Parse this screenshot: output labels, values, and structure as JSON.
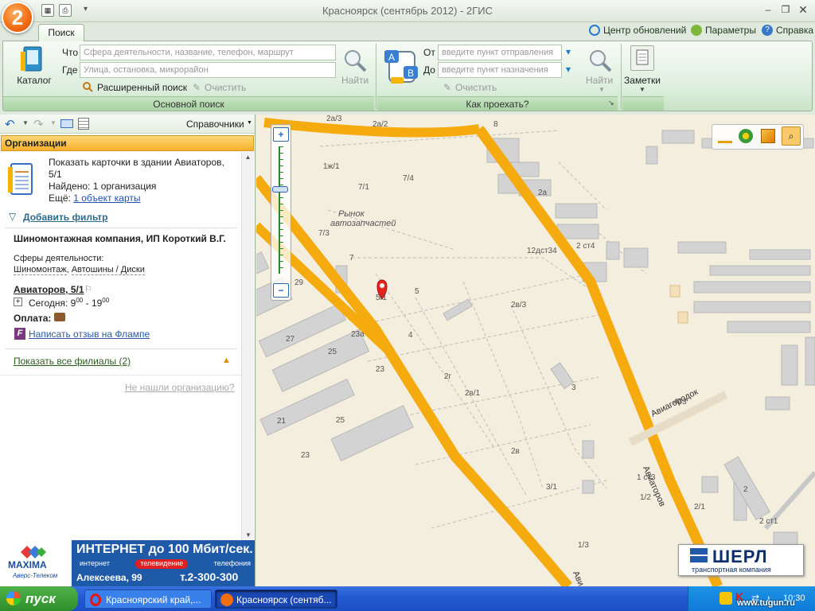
{
  "window": {
    "title": "Красноярск (сентябрь 2012)  -  2ГИС",
    "logo": "2"
  },
  "tabs": {
    "search": "Поиск"
  },
  "topright": {
    "updates": "Центр обновлений",
    "params": "Параметры",
    "help": "Справка"
  },
  "search": {
    "catalog": "Каталог",
    "what_label": "Что",
    "what_placeholder": "Сфера деятельности, название, телефон, маршрут",
    "where_label": "Где",
    "where_placeholder": "Улица, остановка, микрорайон",
    "find": "Найти",
    "advanced": "Расширенный поиск",
    "clear": "Очистить",
    "group": "Основной поиск"
  },
  "route": {
    "from_label": "От",
    "from_placeholder": "введите пункт отправления",
    "to_label": "До",
    "to_placeholder": "введите пункт назначения",
    "find": "Найти",
    "clear": "Очистить",
    "group": "Как проехать?"
  },
  "notes": {
    "label": "Заметки"
  },
  "panel": {
    "directory": "Справочники",
    "header": "Организации",
    "building_cards": "Показать карточки в здании Авиаторов, 5/1",
    "found": "Найдено: 1 организация",
    "more_prefix": "Ещё:",
    "more_link": "1 объект карты",
    "add_filter": "Добавить фильтр",
    "org_name": "Шиномонтажная компания, ИП Короткий В.Г.",
    "spheres_label": "Сферы деятельности:",
    "sphere1": "Шиномонтаж",
    "sphere2": "Автошины / Диски",
    "address": "Авиаторов, 5/1",
    "today": "Сегодня:",
    "open_h": "9",
    "open_m": "00",
    "close_h": "19",
    "close_m": "00",
    "payment": "Оплата:",
    "review": "Написать отзыв на Флампе",
    "branches": "Показать все филиалы (2)",
    "not_found": "Не нашли организацию?"
  },
  "ad": {
    "brand": "MAXIMA",
    "slogan": "ИНТЕРНЕТ до 100 Мбит/сек.",
    "tags": [
      "интернет",
      "телевидение",
      "телефония"
    ],
    "address": "Алексеева, 99",
    "phone": "т.2-300-300",
    "sub": "Аверс-Телеком"
  },
  "map": {
    "street1": "Авиаторов",
    "street2": "Авиагородок",
    "market1": "Рынок",
    "market2": "автозапчастей",
    "labels": [
      "2а/3",
      "2а/2",
      "8",
      "1ж/1",
      "7/4",
      "7/1",
      "2а",
      "7/3",
      "7",
      "12дст34",
      "2 ст4",
      "29",
      "5/1",
      "5",
      "2в/3",
      "27",
      "23а",
      "4",
      "25",
      "23",
      "2г",
      "2в/1",
      "3",
      "21",
      "25",
      "23",
      "463",
      "2в",
      "1 ст3",
      "3/1",
      "1/2",
      "2/1",
      "2",
      "2 ст1",
      "1/3"
    ],
    "ad_text": "ШЕРЛ",
    "ad_sub": "транспортная компания"
  },
  "taskbar": {
    "start": "пуск",
    "item1": "Красноярский край,...",
    "item2": "Красноярск (сентяб...",
    "lang": "RL",
    "time": "10:30",
    "watermark": "www.tugun.ru"
  }
}
